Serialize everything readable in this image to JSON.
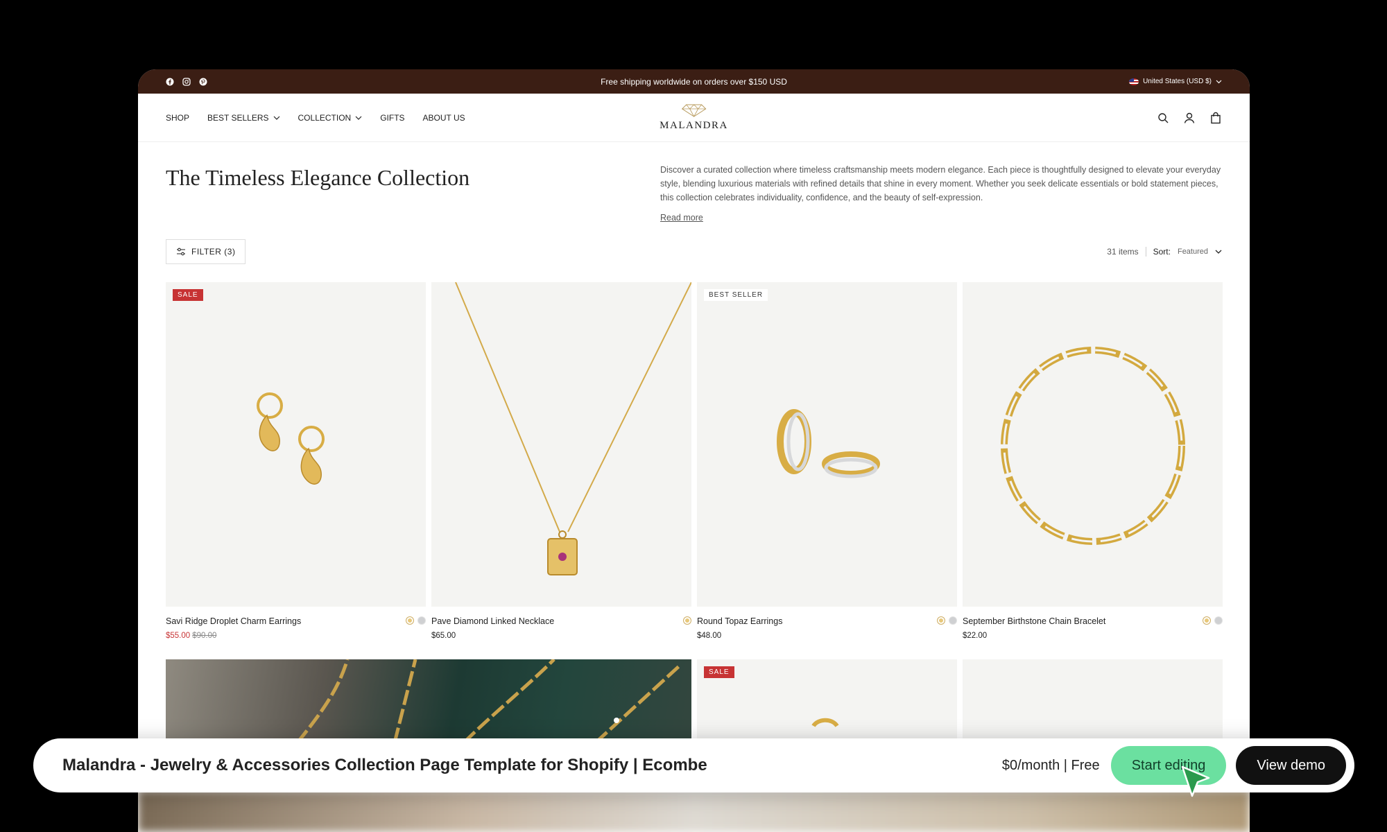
{
  "announcement": {
    "text": "Free shipping worldwide on orders over $150 USD",
    "locale": "United States (USD $)",
    "socials": [
      "facebook-icon",
      "instagram-icon",
      "pinterest-icon"
    ]
  },
  "header": {
    "nav": [
      "SHOP",
      "BEST SELLERS",
      "COLLECTION",
      "GIFTS",
      "ABOUT US"
    ],
    "logo_text": "MALANDRA",
    "icons": [
      "search-icon",
      "account-icon",
      "cart-icon"
    ]
  },
  "collection": {
    "title": "The Timeless Elegance Collection",
    "description": "Discover a curated collection where timeless craftsmanship meets modern elegance. Each piece is thoughtfully designed to elevate your everyday style, blending luxurious materials with refined details that shine in every moment. Whether you seek delicate essentials or bold statement pieces, this collection celebrates individuality, confidence, and the beauty of self-expression.",
    "read_more": "Read more"
  },
  "toolbar": {
    "filter_label": "FILTER (3)",
    "item_count": "31 items",
    "sort_label": "Sort:",
    "sort_value": "Featured"
  },
  "products": [
    {
      "name": "Savi Ridge Droplet Charm Earrings",
      "price": "$55.00",
      "compare_price": "$90.00",
      "badge": "SALE"
    },
    {
      "name": "Pave Diamond Linked Necklace",
      "price": "$65.00",
      "badge": ""
    },
    {
      "name": "Round Topaz Earrings",
      "price": "$48.00",
      "badge": "BEST SELLER"
    },
    {
      "name": "September Birthstone Chain Bracelet",
      "price": "$22.00",
      "badge": ""
    }
  ],
  "row2": {
    "badge": "SALE"
  },
  "promo_bar": {
    "title": "Malandra - Jewelry & Accessories Collection Page Template for Shopify | Ecombe",
    "pricing": "$0/month | Free",
    "start_label": "Start editing",
    "demo_label": "View demo"
  },
  "colors": {
    "announcement_bg": "#3b1e14",
    "sale": "#c73334",
    "start_button": "#6be0a0"
  }
}
